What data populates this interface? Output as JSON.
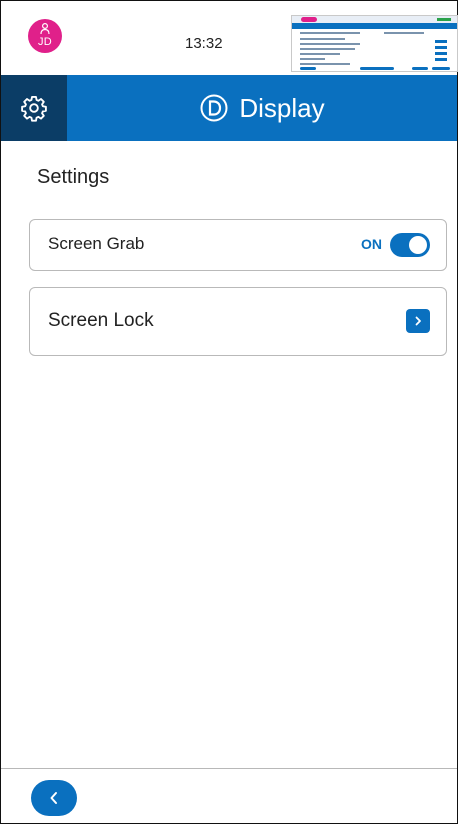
{
  "status_bar": {
    "user_initials": "JD",
    "time": "13:32"
  },
  "header": {
    "title": "Display",
    "icons": [
      "gear-icon",
      "display-d-icon"
    ]
  },
  "main": {
    "section_title": "Settings",
    "items": [
      {
        "label": "Screen Grab",
        "toggle_text": "ON",
        "toggle_state": true
      },
      {
        "label": "Screen Lock",
        "action_icon": "chevron-right-icon"
      }
    ]
  },
  "footer": {
    "back_icon": "chevron-left-icon"
  },
  "colors": {
    "primary": "#0a70bf",
    "header_dark": "#0b3d66",
    "avatar": "#e0208a"
  }
}
